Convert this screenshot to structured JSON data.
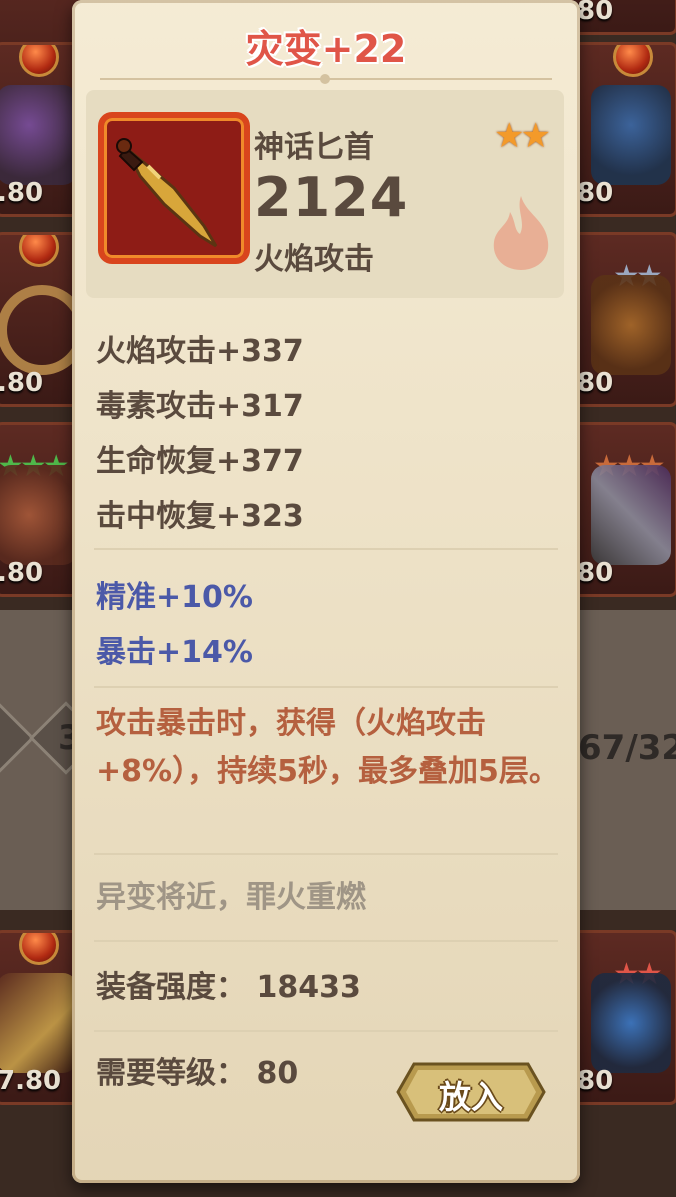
{
  "background": {
    "left_slots": [
      {
        "level": ".80"
      },
      {
        "level": ".80"
      },
      {
        "level": ".80"
      },
      {
        "level": ".80"
      },
      {
        "level": "7.80"
      }
    ],
    "right_slots": [
      {
        "level": "80"
      },
      {
        "level": "80"
      },
      {
        "level": "80"
      },
      {
        "level": "80"
      },
      {
        "level": "80"
      },
      {
        "level": "80"
      }
    ],
    "left_page_number": "3",
    "right_count": "67/32"
  },
  "tooltip": {
    "title": "灾变+22",
    "item_name": "神话匕首",
    "power": "2124",
    "main_attribute": "火焰攻击",
    "rarity_stars": "★★",
    "stats": [
      "火焰攻击+337",
      "毒素攻击+317",
      "生命恢复+377",
      "击中恢复+323"
    ],
    "bonus_stats": [
      "精准+10%",
      "暴击+14%"
    ],
    "effect": "攻击暴击时，获得（火焰攻击+8%），持续5秒，最多叠加5层。",
    "flavor": "异变将近，罪火重燃",
    "gear_strength": "装备强度：  18433",
    "required_level": "需要等级：  80",
    "place_button": "放入"
  },
  "colors": {
    "title": "#e05548",
    "text": "#5a4a3e",
    "bonus": "#4b59a8",
    "effect": "#b5603f",
    "flavor": "#9f9586",
    "panel": "#f3e8cd"
  }
}
